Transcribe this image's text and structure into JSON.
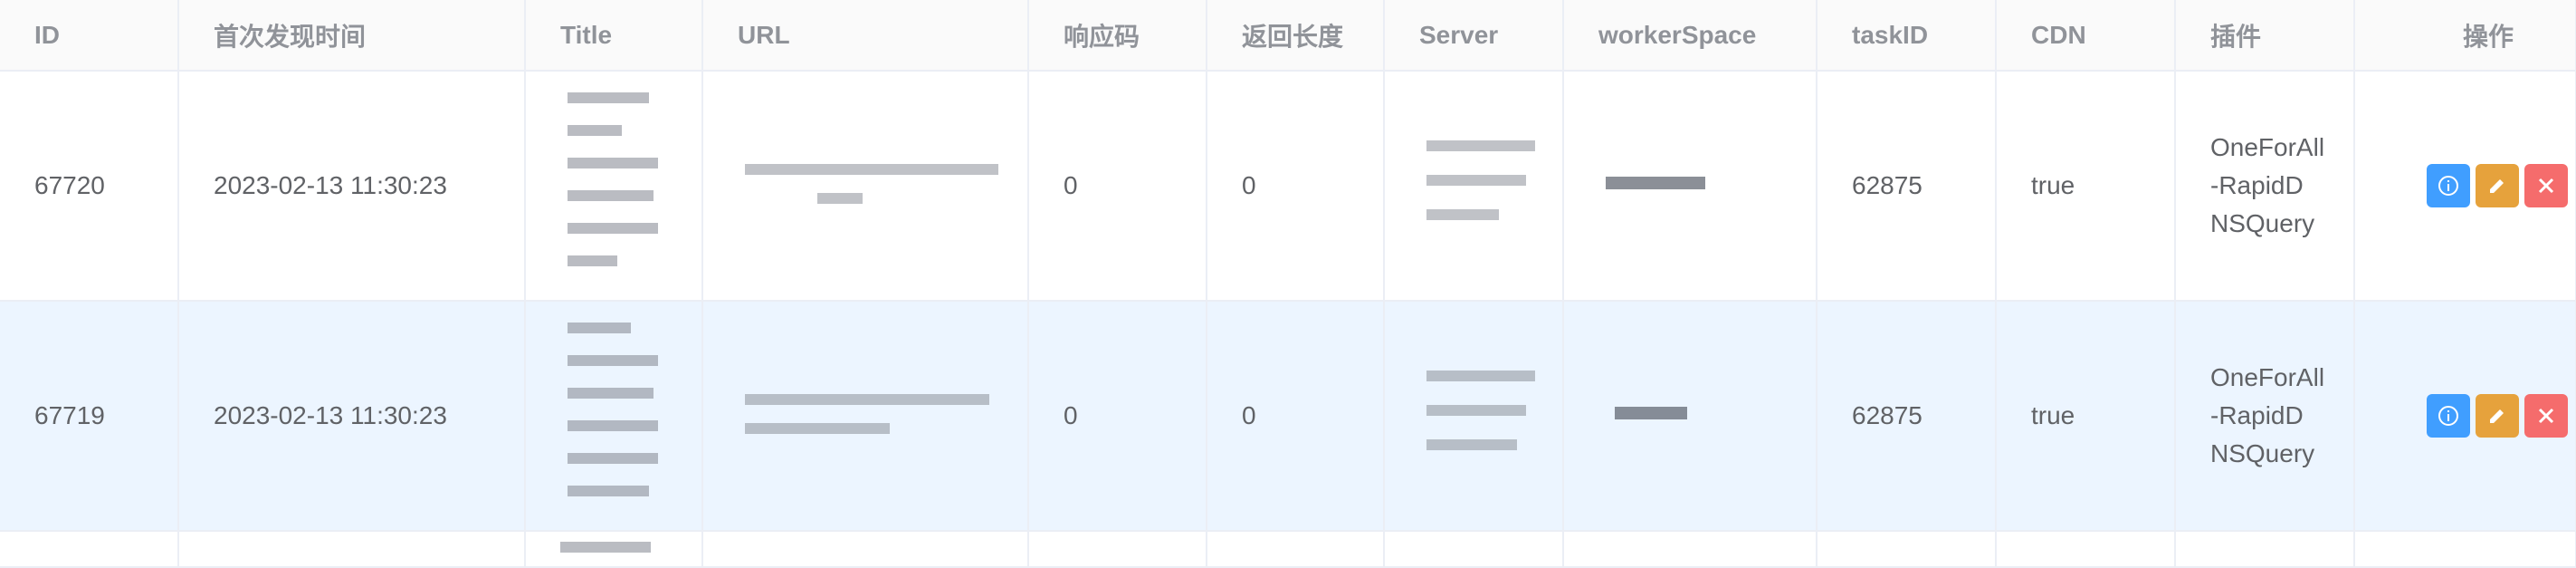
{
  "headers": [
    "ID",
    "首次发现时间",
    "Title",
    "URL",
    "响应码",
    "返回长度",
    "Server",
    "workerSpace",
    "taskID",
    "CDN",
    "插件",
    "操作"
  ],
  "rows": [
    {
      "id": "67720",
      "time": "2023-02-13 11:30:23",
      "title": "",
      "url": "",
      "code": "0",
      "length": "0",
      "server": "",
      "workspace": "",
      "task_id": "62875",
      "cdn": "true",
      "plugin": [
        "OneForAll",
        "-RapidD",
        "NSQuery"
      ]
    },
    {
      "id": "67719",
      "time": "2023-02-13 11:30:23",
      "title": "",
      "url": "",
      "code": "0",
      "length": "0",
      "server": "",
      "workspace": "",
      "task_id": "62875",
      "cdn": "true",
      "plugin": [
        "OneForAll",
        "-RapidD",
        "NSQuery"
      ]
    }
  ],
  "icons": {
    "info": "info-icon",
    "edit": "edit-icon",
    "delete": "close-icon"
  },
  "colors": {
    "info": "#409eff",
    "edit": "#e6a23c",
    "delete": "#f56c6c",
    "row_highlight": "#ecf5ff",
    "header_bg": "#fafafa"
  }
}
